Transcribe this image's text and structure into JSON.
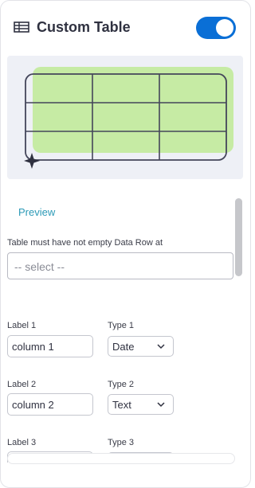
{
  "header": {
    "icon": "table-icon",
    "title": "Custom Table",
    "toggle_on": true,
    "accent_color": "#0a6fd6"
  },
  "preview": {
    "illustration": "table-preview-illustration",
    "highlight_color": "#c6eba4",
    "link_label": "Preview"
  },
  "data_row": {
    "label": "Table must have not empty Data Row at",
    "placeholder": "-- select --"
  },
  "columns": [
    {
      "label_caption": "Label 1",
      "label_value": "column 1",
      "type_caption": "Type 1",
      "type_value": "Date"
    },
    {
      "label_caption": "Label 2",
      "label_value": "column 2",
      "type_caption": "Type 2",
      "type_value": "Text"
    },
    {
      "label_caption": "Label 3",
      "label_value": "",
      "type_caption": "Type 3",
      "type_value": ""
    }
  ]
}
